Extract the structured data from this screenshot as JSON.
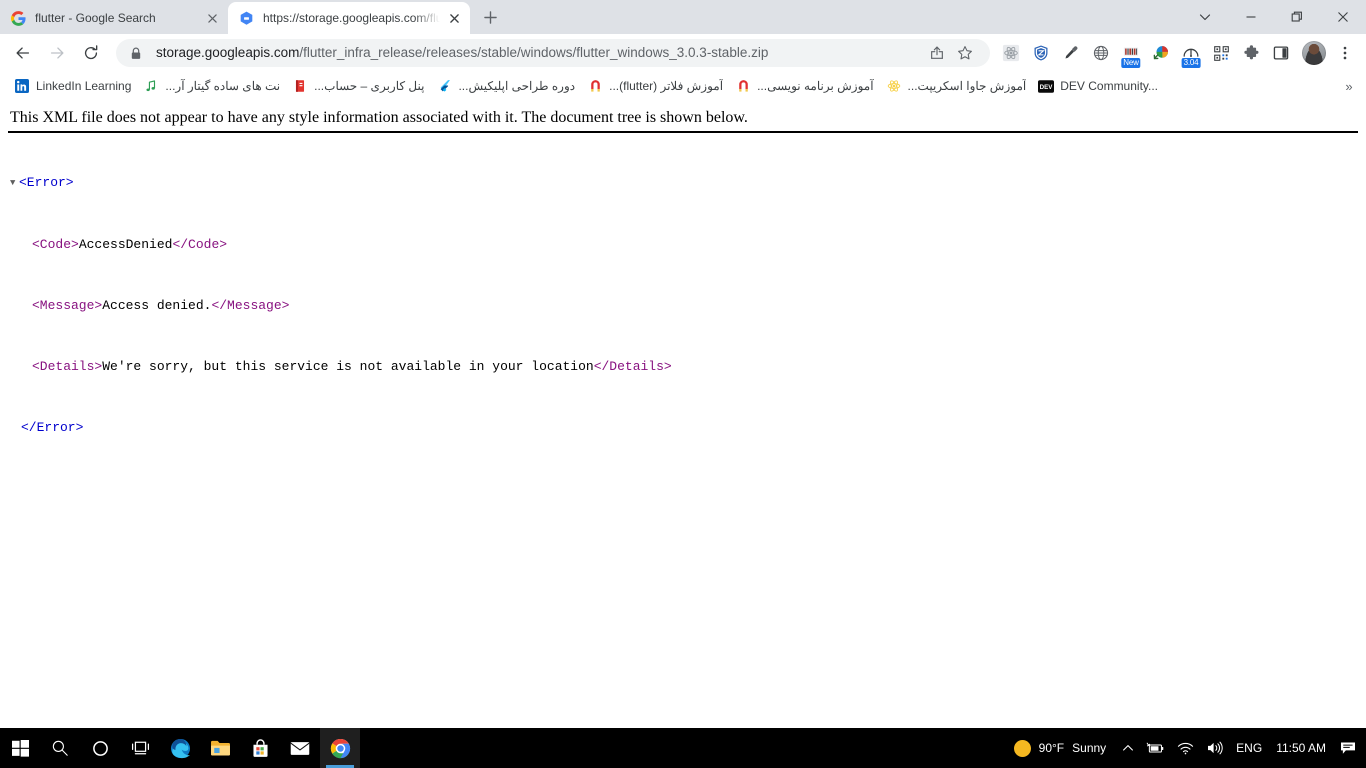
{
  "window": {
    "tab_search_icon": "chevron-down-icon",
    "minimize_label": "—",
    "maximize_label": "❐",
    "close_label": "✕"
  },
  "tabs": [
    {
      "title": "flutter - Google Search",
      "favicon": "google-g-icon",
      "active": false,
      "close_label": "✕"
    },
    {
      "title": "https://storage.googleapis.com/flutter_infra_release",
      "favicon": "cloud-storage-icon",
      "active": true,
      "close_label": "✕"
    }
  ],
  "new_tab": {
    "label": "+",
    "tooltip": "New Tab"
  },
  "toolbar": {
    "back_label": "←",
    "forward_label": "→",
    "reload_label": "↻",
    "lock_icon": "lock-icon",
    "url_host": "storage.googleapis.com",
    "url_path": "/flutter_infra_release/releases/stable/windows/flutter_windows_3.0.3-stable.zip",
    "url_full": "storage.googleapis.com/flutter_infra_release/releases/stable/windows/flutter_windows_3.0.3-stable.zip",
    "share_icon": "share-icon",
    "bookmark_icon": "star-icon",
    "menu_icon": "three-dot-menu-icon",
    "avatar_icon": "profile-avatar"
  },
  "extensions": [
    {
      "name": "react-devtools-icon",
      "badge": ""
    },
    {
      "name": "zenmate-vpn-shield-icon",
      "badge": ""
    },
    {
      "name": "colorpick-eyedropper-icon",
      "badge": ""
    },
    {
      "name": "globe-proxy-icon",
      "badge": ""
    },
    {
      "name": "ublock-bars-icon",
      "badge": "New"
    },
    {
      "name": "internet-download-manager-icon",
      "badge": ""
    },
    {
      "name": "speedtest-gauge-icon",
      "badge": "3.04"
    },
    {
      "name": "qr-code-icon",
      "badge": ""
    },
    {
      "name": "extensions-puzzle-icon",
      "badge": ""
    },
    {
      "name": "side-panel-icon",
      "badge": ""
    }
  ],
  "bookmarks": {
    "items": [
      {
        "label": "LinkedIn Learning",
        "icon": "linkedin-icon",
        "rtl": false
      },
      {
        "label": "نت های ساده گیتار آر...",
        "icon": "music-note-icon",
        "rtl": true
      },
      {
        "label": "پنل کاربری – حساب...",
        "icon": "red-book-icon",
        "rtl": true
      },
      {
        "label": "دوره طراحی اپلیکیش...",
        "icon": "flutter-icon",
        "rtl": true
      },
      {
        "label": "آموزش فلاتر (flutter)...",
        "icon": "magnet-icon",
        "rtl": true
      },
      {
        "label": "آموزش برنامه نویسی...",
        "icon": "magnet-icon",
        "rtl": true
      },
      {
        "label": "آموزش جاوا اسکریپت...",
        "icon": "javascript-atom-icon",
        "rtl": true
      },
      {
        "label": "DEV Community...",
        "icon": "dev-community-icon",
        "rtl": false
      }
    ],
    "overflow_label": "»"
  },
  "page": {
    "notice": "This XML file does not appear to have any style information associated with it. The document tree is shown below.",
    "twisty": "▼",
    "xml": {
      "root_open": "<Error>",
      "root_close": "</Error>",
      "nodes": [
        {
          "tag": "Code",
          "open": "<Code>",
          "value": "AccessDenied",
          "close": "</Code>"
        },
        {
          "tag": "Message",
          "open": "<Message>",
          "value": "Access denied.",
          "close": "</Message>"
        },
        {
          "tag": "Details",
          "open": "<Details>",
          "value": "We're sorry, but this service is not available in your location",
          "close": "</Details>"
        }
      ]
    },
    "colors": {
      "tag": "#881280",
      "punct": "#0000cd",
      "text": "#000000"
    }
  },
  "taskbar": {
    "items": [
      {
        "name": "start-button",
        "active": false
      },
      {
        "name": "search-icon",
        "active": false
      },
      {
        "name": "cortana-icon",
        "active": false
      },
      {
        "name": "task-view-icon",
        "active": false
      },
      {
        "name": "microsoft-edge-icon",
        "active": false
      },
      {
        "name": "file-explorer-icon",
        "active": false
      },
      {
        "name": "microsoft-store-icon",
        "active": false
      },
      {
        "name": "mail-icon",
        "active": false
      },
      {
        "name": "google-chrome-icon",
        "active": true
      }
    ],
    "tray": {
      "weather_temp": "90°F",
      "weather_desc": "Sunny",
      "weather_icon": "sun-icon",
      "chevron": "∧",
      "battery_icon": "battery-charging-icon",
      "wifi_icon": "wifi-icon",
      "volume_icon": "volume-icon",
      "language": "ENG",
      "time": "11:50 AM",
      "action_center_icon": "notification-icon"
    }
  }
}
